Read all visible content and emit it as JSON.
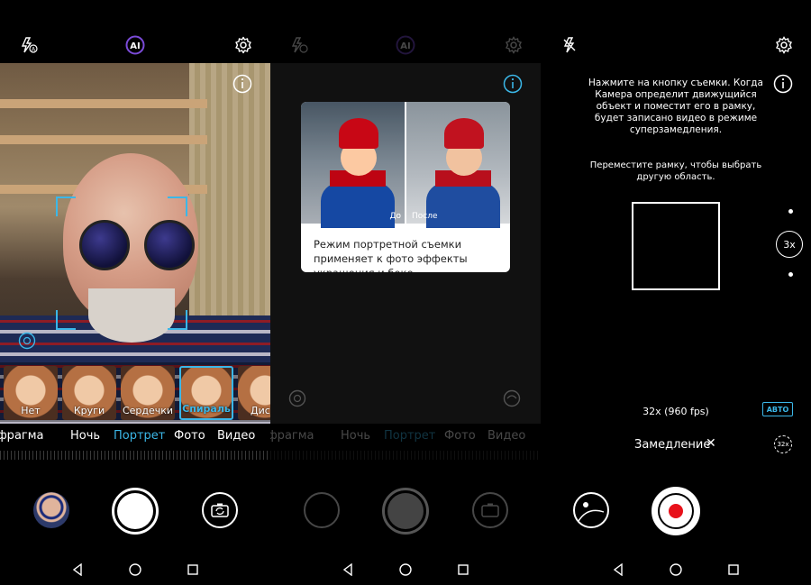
{
  "colors": {
    "accent": "#3bb7e8",
    "record": "#e8111a"
  },
  "screen1": {
    "filters": [
      {
        "label": "Нет"
      },
      {
        "label": "Круги"
      },
      {
        "label": "Сердечки"
      },
      {
        "label": "Спираль",
        "selected": true
      },
      {
        "label": "Диск"
      }
    ],
    "modes": [
      "Диафрагма",
      "Ночь",
      "Портрет",
      "Фото",
      "Видео"
    ],
    "active_mode": "Портрет"
  },
  "screen2": {
    "tooltip": {
      "before": "До",
      "after": "После",
      "text": "Режим портретной съемки применяет к фото эффекты украшения и боке."
    },
    "modes": [
      "Диафрагма",
      "Ночь",
      "Портрет",
      "Фото",
      "Видео"
    ]
  },
  "screen3": {
    "instructions": "Нажмите на кнопку съемки. Когда Камера определит движущийся объект и поместит его в рамку, будет записано видео в режиме суперзамедления.",
    "hint": "Переместите рамку, чтобы выбрать другую область.",
    "zoom": "3x",
    "fps": "32x (960 fps)",
    "auto": "АВТО",
    "slowmo_label": "Замедление",
    "close": "✕",
    "speed_badge": "32x"
  }
}
